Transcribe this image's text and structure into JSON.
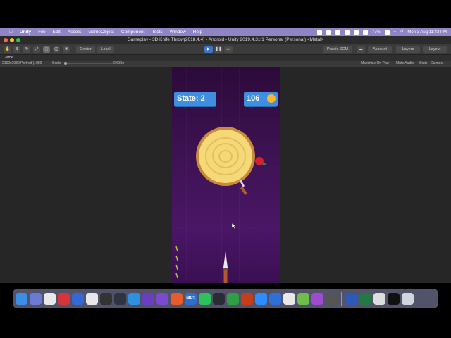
{
  "menubar": {
    "apple": "",
    "app": "Unity",
    "items": [
      "File",
      "Edit",
      "Assets",
      "GameObject",
      "Component",
      "Tools",
      "Window",
      "Help"
    ],
    "battery": "77%",
    "datetime": "Mon 3 Aug  11:43 PM"
  },
  "window": {
    "title": "Gameplay - 3D Knife Throw(2018.4.4) - Android - Unity 2019.4.31f1 Personal (Personal) <Metal>"
  },
  "toolbar": {
    "center": "Center",
    "local": "Local",
    "plastic": "Plastic SCM",
    "account": "Account",
    "layers": "Layers",
    "layout": "Layout"
  },
  "game_view": {
    "tab": "Game",
    "resolution": "2160x1080 Portrait (1080",
    "scale_label": "Scale",
    "scale_value": "0.639x",
    "maximize": "Maximize On Play",
    "mute": "Mute Audio",
    "stats": "Stats",
    "gizmos": "Gizmos"
  },
  "game": {
    "state_label": "State: 2",
    "score": "106"
  },
  "dock": {
    "apps": [
      {
        "name": "finder-icon",
        "label": "",
        "color": "#3a8ee6"
      },
      {
        "name": "launchpad-icon",
        "label": "",
        "color": "#6c7ad6"
      },
      {
        "name": "chrome-icon",
        "label": "",
        "color": "#e8e8e8"
      },
      {
        "name": "app-red-icon",
        "label": "",
        "color": "#d8343b"
      },
      {
        "name": "app-blue-icon",
        "label": "",
        "color": "#3568d4"
      },
      {
        "name": "app-wave-icon",
        "label": "",
        "color": "#e8e8e8"
      },
      {
        "name": "app-dark-icon",
        "label": "",
        "color": "#333333"
      },
      {
        "name": "app-monitor-icon",
        "label": "",
        "color": "#2e3440"
      },
      {
        "name": "safari-icon",
        "label": "",
        "color": "#2e90e0"
      },
      {
        "name": "vscode-icon",
        "label": "",
        "color": "#6a3fbf"
      },
      {
        "name": "visualstudio-icon",
        "label": "",
        "color": "#7a4ad0"
      },
      {
        "name": "app-orange-icon",
        "label": "",
        "color": "#e85c2c"
      },
      {
        "name": "mp3-icon",
        "label": "MP3",
        "color": "#2c6fd0"
      },
      {
        "name": "whatsapp-icon",
        "label": "",
        "color": "#2cc35a"
      },
      {
        "name": "app-chart-icon",
        "label": "",
        "color": "#2b2b36"
      },
      {
        "name": "app-green-icon",
        "label": "",
        "color": "#2ea043"
      },
      {
        "name": "powerpoint-icon",
        "label": "",
        "color": "#c43e1c"
      },
      {
        "name": "zoom-icon",
        "label": "",
        "color": "#2d8cff"
      },
      {
        "name": "app-diamond-icon",
        "label": "",
        "color": "#2e6fd8"
      },
      {
        "name": "app-slack-icon",
        "label": "",
        "color": "#e8e8e8"
      },
      {
        "name": "android-icon",
        "label": "",
        "color": "#6bbf4a"
      },
      {
        "name": "app-purple-icon",
        "label": "",
        "color": "#a04ad0"
      },
      {
        "name": "app-gear-icon",
        "label": "",
        "color": "#555555"
      }
    ],
    "apps_right": [
      {
        "name": "word-icon",
        "label": "",
        "color": "#2b5ab8"
      },
      {
        "name": "excel-icon",
        "label": "",
        "color": "#1f7a44"
      },
      {
        "name": "app-screen-icon",
        "label": "",
        "color": "#dddddd"
      },
      {
        "name": "unity-icon",
        "label": "",
        "color": "#111111"
      },
      {
        "name": "trash-icon",
        "label": "",
        "color": "#cfd6de"
      }
    ]
  }
}
